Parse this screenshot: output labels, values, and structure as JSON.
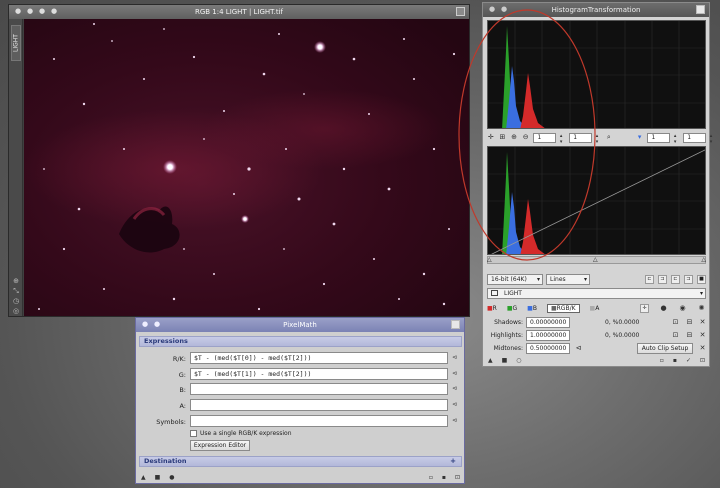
{
  "image_window": {
    "title": "RGB 1:4 LIGHT | LIGHT.tif",
    "tab_label": "LIGHT",
    "icons": [
      "zoom-icon",
      "shrink-icon",
      "properties-icon",
      "nav-icon"
    ]
  },
  "histogram_window": {
    "title": "HistogramTransformation",
    "toolbar1": {
      "zoom_h": "1",
      "zoom_v": "1",
      "zoom_h2": "1",
      "zoom_v2": "1"
    },
    "depth_select": "16-bit (64K)",
    "graph_style_select": "Lines",
    "view_select": "LIGHT",
    "channels": {
      "r": "R",
      "g": "G",
      "b": "B",
      "rgbk": "RGB/K",
      "a": "A"
    },
    "shadows": {
      "label": "Shadows:",
      "value": "0.00000000",
      "clip": "0, %0.0000"
    },
    "highlights": {
      "label": "Highlights:",
      "value": "1.00000000",
      "clip": "0, %0.0000"
    },
    "midtones": {
      "label": "Midtones:",
      "value": "0.50000000"
    },
    "auto_clip_label": "Auto Clip Setup"
  },
  "pixelmath_window": {
    "title": "PixelMath",
    "expressions_header": "Expressions",
    "rk_label": "R/K:",
    "rk_value": "$T - (med($T[0]) - med($T[2]))",
    "g_label": "G:",
    "g_value": "$T - (med($T[1]) - med($T[2]))",
    "b_label": "B:",
    "b_value": "",
    "a_label": "A:",
    "a_value": "",
    "symbols_label": "Symbols:",
    "symbols_value": "",
    "single_expr_label": "Use a single RGB/K expression",
    "expression_editor_label": "Expression Editor",
    "destination_header": "Destination"
  },
  "colors": {
    "red_hist": "#d42a2a",
    "green_hist": "#2aa02a",
    "blue_hist": "#3a6ee0",
    "annotation_ellipse": "#c0392b",
    "nebula": "#5a1530"
  }
}
